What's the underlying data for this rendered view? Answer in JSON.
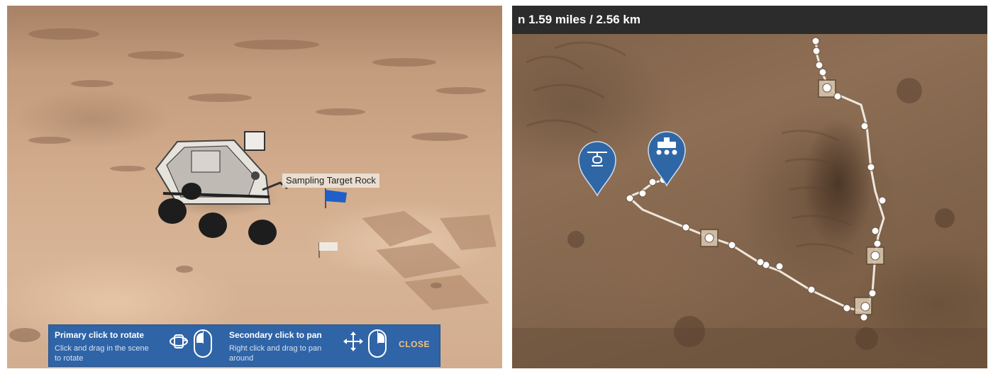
{
  "scene": {
    "target_label": "Sampling Target Rock",
    "help": {
      "rotate_title": "Primary click to rotate",
      "rotate_desc": "Click and drag in the scene to rotate",
      "pan_title": "Secondary click to pan",
      "pan_desc": "Right click and drag to pan around",
      "close_label": "CLOSE"
    },
    "icons": [
      "rotate-icon",
      "mouse-left-click-icon",
      "pan-arrows-icon",
      "mouse-right-click-icon"
    ]
  },
  "map": {
    "distance_text": "n 1.59 miles / 2.56 km",
    "markers": [
      "helicopter-marker",
      "rover-marker"
    ],
    "colors": {
      "marker_blue": "#2f67a6",
      "path": "#f4efe8",
      "bar": "#2c2c2c"
    }
  },
  "colors": {
    "help_bar": "#2f64a7",
    "close_text": "#f3c27c"
  }
}
